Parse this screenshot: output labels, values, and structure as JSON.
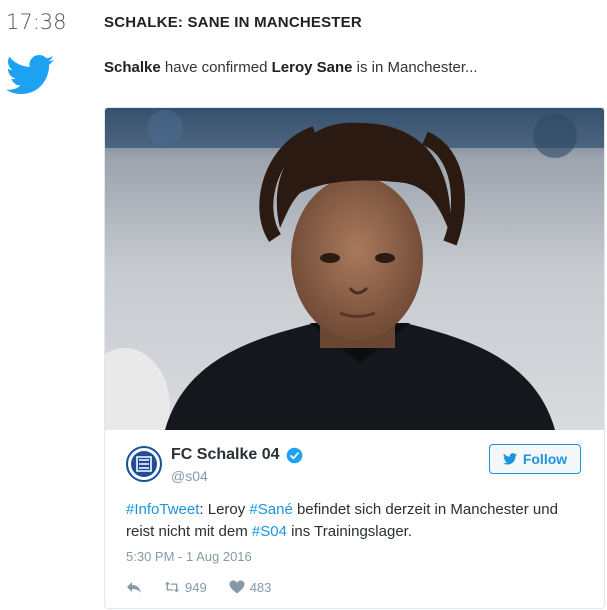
{
  "entry": {
    "time": "17:38",
    "headline": "SCHALKE: SANE IN MANCHESTER",
    "summary": {
      "part1": "Schalke",
      "part2": " have confirmed ",
      "part3": "Leroy Sane",
      "part4": " is in Manchester..."
    },
    "icon": "twitter-bird-icon"
  },
  "embed": {
    "account_name": "FC Schalke 04",
    "handle": "@s04",
    "verified": true,
    "follow_label": "Follow",
    "tweet_parts": [
      {
        "text": "#InfoTweet",
        "hashtag": true
      },
      {
        "text": ": Leroy ",
        "hashtag": false
      },
      {
        "text": "#Sané",
        "hashtag": true
      },
      {
        "text": " befindet sich derzeit in Manchester und reist nicht mit dem ",
        "hashtag": false
      },
      {
        "text": "#S04",
        "hashtag": true
      },
      {
        "text": " ins Trainingslager.",
        "hashtag": false
      }
    ],
    "date": "5:30 PM - 1 Aug 2016",
    "retweets": "949",
    "likes": "483"
  },
  "colors": {
    "link": "#1b95e0",
    "twitter_blue": "#1da1f2",
    "muted": "#8899a6"
  }
}
